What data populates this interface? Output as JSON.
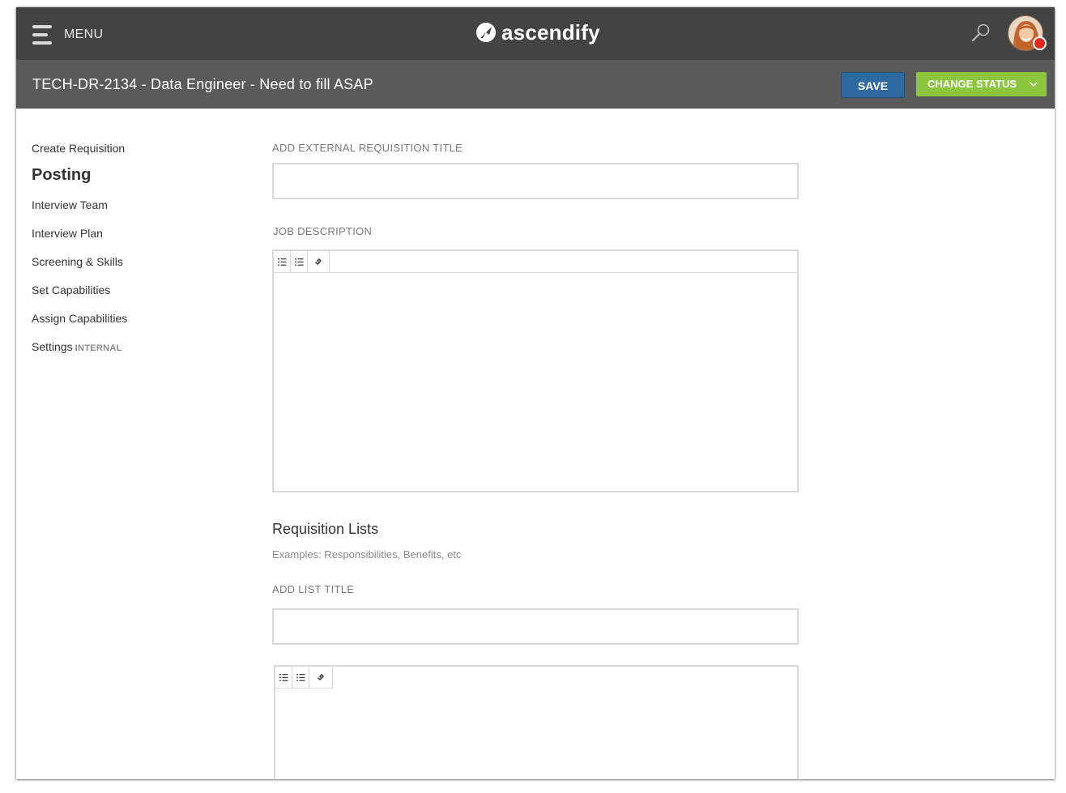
{
  "nav": {
    "menu_label": "MENU",
    "logo_text": "ascendify"
  },
  "header": {
    "title": "TECH-DR-2134 - Data Engineer - Need to fill ASAP",
    "save_label": "SAVE",
    "change_status_label": "CHANGE STATUS"
  },
  "sidebar": {
    "items": [
      {
        "label": "Create Requisition"
      },
      {
        "label": "Posting"
      },
      {
        "label": "Interview Team"
      },
      {
        "label": "Interview Plan"
      },
      {
        "label": "Screening & Skills"
      },
      {
        "label": "Set Capabilities"
      },
      {
        "label": "Assign Capabilities"
      },
      {
        "label": "Settings",
        "tag": "INTERNAL"
      }
    ]
  },
  "main": {
    "external_title_label": "ADD EXTERNAL REQUISITION TITLE",
    "external_title_value": "",
    "job_description_label": "JOB DESCRIPTION",
    "lists_heading": "Requisition Lists",
    "lists_subtext": "Examples: Responsibilities, Benefits, etc",
    "list_title_label": "ADD LIST TITLE",
    "list_title_value": ""
  },
  "icons": {
    "menu": "hamburger-icon",
    "logo": "ascendify-logo-icon",
    "search": "search-icon",
    "avatar": "user-avatar",
    "status_chevron": "chevron-down-icon",
    "editor_tools": [
      "numbered-list-icon",
      "bullet-list-icon",
      "link-icon"
    ]
  },
  "colors": {
    "topbar": "#434343",
    "titlebar": "#5a5a5a",
    "save_button": "#2d6aa0",
    "status_button": "#8cc63f",
    "notification_dot": "#e02b1c"
  }
}
